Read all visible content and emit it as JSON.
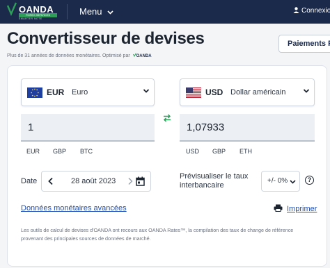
{
  "header": {
    "logo_text": "OANDA",
    "logo_badge": "FOREX SERVICES",
    "logo_tagline": "SMARTER NOTE",
    "menu_label": "Menu",
    "login_label": "Connexion"
  },
  "page": {
    "title": "Convertisseur de devises",
    "subtitle": "Plus de 31 années de données monétaires. Optimisé par",
    "subtitle_logo": "OANDA",
    "payments_button": "Paiements F..."
  },
  "converter": {
    "from": {
      "code": "EUR",
      "name": "Euro",
      "amount": "1",
      "quick": [
        "EUR",
        "GBP",
        "BTC"
      ]
    },
    "to": {
      "code": "USD",
      "name": "Dollar américain",
      "amount": "1,07933",
      "quick": [
        "USD",
        "GBP",
        "ETH"
      ]
    },
    "date_label": "Date",
    "date_value": "28 août 2023",
    "interbank_label": "Prévisualiser le taux interbancaire",
    "interbank_value": "+/- 0%",
    "help_label": "?",
    "advanced_link": "Données monétaires avancées",
    "print_label": "Imprimer",
    "disclaimer": "Les outils de calcul de devises d'OANDA ont recours aux OANDA Rates™, la compilation des taux de change de référence provenant des principales sources de données de marché."
  },
  "colors": {
    "topbar": "#1b2a4a",
    "link": "#1f4fb5",
    "brand_green": "#2e9e5a"
  }
}
